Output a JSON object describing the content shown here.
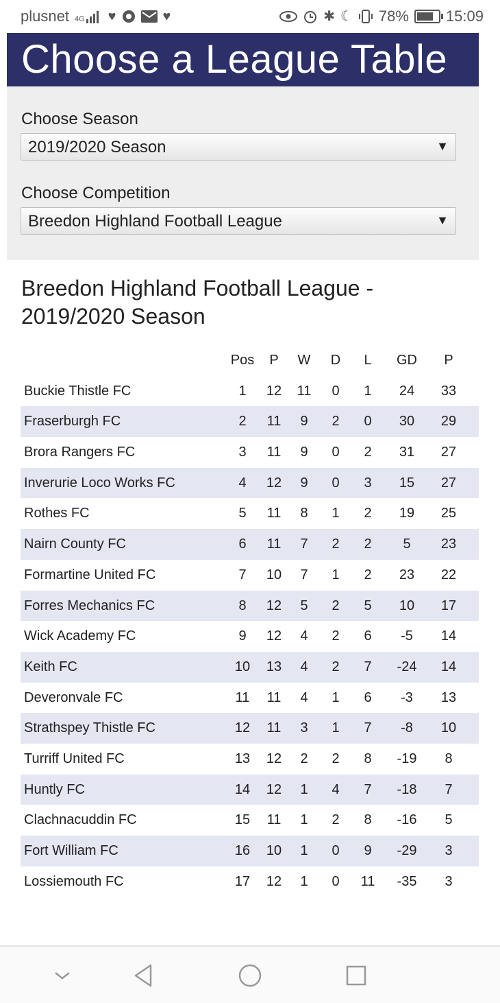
{
  "status_bar": {
    "carrier": "plusnet",
    "network": "4G",
    "battery": "78%",
    "battery_level": 0.78,
    "time": "15:09"
  },
  "header": {
    "title": "Choose a League Table"
  },
  "filters": {
    "season_label": "Choose Season",
    "season_value": "2019/2020 Season",
    "competition_label": "Choose Competition",
    "competition_value": "Breedon Highland Football League"
  },
  "table_title": "Breedon Highland Football League - 2019/2020 Season",
  "table": {
    "columns": [
      "",
      "Pos",
      "P",
      "W",
      "D",
      "L",
      "GD",
      "P"
    ],
    "rows": [
      {
        "team": "Buckie Thistle FC",
        "pos": "1",
        "p": "12",
        "w": "11",
        "d": "0",
        "l": "1",
        "gd": "24",
        "pts": "33"
      },
      {
        "team": "Fraserburgh FC",
        "pos": "2",
        "p": "11",
        "w": "9",
        "d": "2",
        "l": "0",
        "gd": "30",
        "pts": "29"
      },
      {
        "team": "Brora Rangers FC",
        "pos": "3",
        "p": "11",
        "w": "9",
        "d": "0",
        "l": "2",
        "gd": "31",
        "pts": "27"
      },
      {
        "team": "Inverurie Loco Works FC",
        "pos": "4",
        "p": "12",
        "w": "9",
        "d": "0",
        "l": "3",
        "gd": "15",
        "pts": "27"
      },
      {
        "team": "Rothes FC",
        "pos": "5",
        "p": "11",
        "w": "8",
        "d": "1",
        "l": "2",
        "gd": "19",
        "pts": "25"
      },
      {
        "team": "Nairn County FC",
        "pos": "6",
        "p": "11",
        "w": "7",
        "d": "2",
        "l": "2",
        "gd": "5",
        "pts": "23"
      },
      {
        "team": "Formartine United FC",
        "pos": "7",
        "p": "10",
        "w": "7",
        "d": "1",
        "l": "2",
        "gd": "23",
        "pts": "22"
      },
      {
        "team": "Forres Mechanics FC",
        "pos": "8",
        "p": "12",
        "w": "5",
        "d": "2",
        "l": "5",
        "gd": "10",
        "pts": "17"
      },
      {
        "team": "Wick Academy FC",
        "pos": "9",
        "p": "12",
        "w": "4",
        "d": "2",
        "l": "6",
        "gd": "-5",
        "pts": "14"
      },
      {
        "team": "Keith FC",
        "pos": "10",
        "p": "13",
        "w": "4",
        "d": "2",
        "l": "7",
        "gd": "-24",
        "pts": "14"
      },
      {
        "team": "Deveronvale FC",
        "pos": "11",
        "p": "11",
        "w": "4",
        "d": "1",
        "l": "6",
        "gd": "-3",
        "pts": "13"
      },
      {
        "team": "Strathspey Thistle FC",
        "pos": "12",
        "p": "11",
        "w": "3",
        "d": "1",
        "l": "7",
        "gd": "-8",
        "pts": "10"
      },
      {
        "team": "Turriff United FC",
        "pos": "13",
        "p": "12",
        "w": "2",
        "d": "2",
        "l": "8",
        "gd": "-19",
        "pts": "8"
      },
      {
        "team": "Huntly FC",
        "pos": "14",
        "p": "12",
        "w": "1",
        "d": "4",
        "l": "7",
        "gd": "-18",
        "pts": "7"
      },
      {
        "team": "Clachnacuddin FC",
        "pos": "15",
        "p": "11",
        "w": "1",
        "d": "2",
        "l": "8",
        "gd": "-16",
        "pts": "5"
      },
      {
        "team": "Fort William FC",
        "pos": "16",
        "p": "10",
        "w": "1",
        "d": "0",
        "l": "9",
        "gd": "-29",
        "pts": "3"
      },
      {
        "team": "Lossiemouth FC",
        "pos": "17",
        "p": "12",
        "w": "1",
        "d": "0",
        "l": "11",
        "gd": "-35",
        "pts": "3"
      }
    ]
  },
  "colors": {
    "header_bg": "#2d3068",
    "panel_bg": "#eeeeee",
    "row_alt": "#e4e6f2"
  }
}
